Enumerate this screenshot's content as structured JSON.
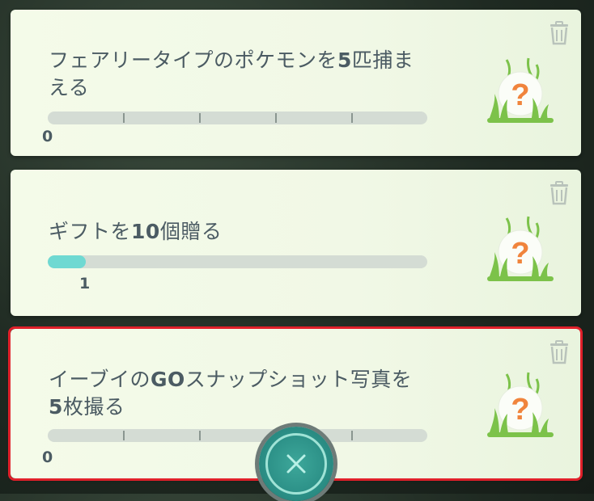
{
  "tasks": [
    {
      "text_parts": [
        "フェアリータイプのポケモンを",
        "5",
        "匹捕まえる"
      ],
      "text_line2": "える",
      "progress": 0,
      "target": 5,
      "count_label": "0",
      "reward_icon": "mystery-grass-question-icon"
    },
    {
      "text_parts": [
        "ギフトを",
        "10",
        "個贈る"
      ],
      "progress": 1,
      "target": 10,
      "count_label": "1",
      "reward_icon": "mystery-grass-question-icon"
    },
    {
      "text_parts": [
        "イーブイの",
        "GO",
        "スナップショット写真を"
      ],
      "text_line2_parts": [
        "5",
        "枚撮る"
      ],
      "progress": 0,
      "target": 5,
      "count_label": "0",
      "reward_icon": "mystery-grass-question-icon"
    }
  ],
  "icons": {
    "trash": "trash-icon",
    "close": "close-icon"
  },
  "colors": {
    "card_bg": "#f4fbe9",
    "progress_fill": "#6fd9d2",
    "progress_track": "#d4dcd4",
    "text": "#4b5b63",
    "highlight": "#e0202a",
    "close_button": "#2b8f86",
    "question_mark": "#f0843c",
    "grass": "#7cc24a"
  }
}
